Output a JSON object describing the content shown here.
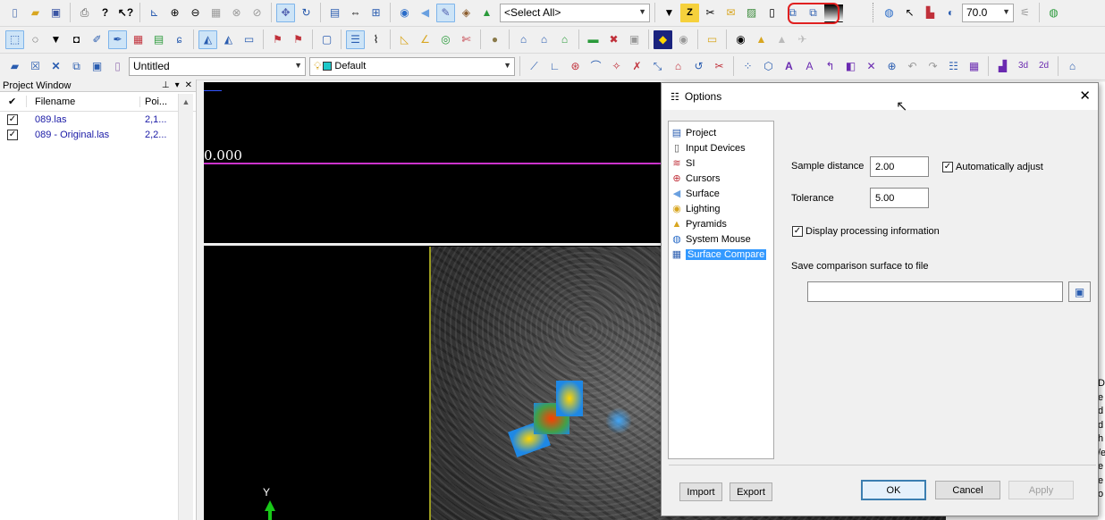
{
  "toolbar1": {
    "layer_select": "<Select All>",
    "zoom_value": "70.0"
  },
  "toolbar3": {
    "project_name": "Untitled",
    "style_select": "Default"
  },
  "project_window": {
    "title": "Project Window",
    "col_check": "✔",
    "col_filename": "Filename",
    "col_points": "Poi...",
    "files": [
      {
        "name": "089.las",
        "points": "2,1...",
        "checked": true
      },
      {
        "name": "089 - Original.las",
        "points": "2,2...",
        "checked": true
      }
    ]
  },
  "viewport": {
    "profile_value": "0.000",
    "axis_label": "Y"
  },
  "dialog": {
    "title": "Options",
    "tree": [
      {
        "label": "Project",
        "icon": "project-icon",
        "selected": false
      },
      {
        "label": "Input Devices",
        "icon": "input-devices-icon",
        "selected": false
      },
      {
        "label": "SI",
        "icon": "si-icon",
        "selected": false
      },
      {
        "label": "Cursors",
        "icon": "crosshair-icon",
        "selected": false
      },
      {
        "label": "Surface",
        "icon": "surface-icon",
        "selected": false
      },
      {
        "label": "Lighting",
        "icon": "bulb-icon",
        "selected": false
      },
      {
        "label": "Pyramids",
        "icon": "pyramid-icon",
        "selected": false
      },
      {
        "label": "System Mouse",
        "icon": "mouse-icon",
        "selected": false
      },
      {
        "label": "Surface Compare",
        "icon": "surface-compare-icon",
        "selected": true
      }
    ],
    "sample_distance_label": "Sample distance",
    "sample_distance_value": "2.00",
    "auto_adjust_label": "Automatically adjust",
    "tolerance_label": "Tolerance",
    "tolerance_value": "5.00",
    "display_processing_label": "Display processing information",
    "save_surface_label": "Save comparison surface to file",
    "save_path_value": "",
    "import_label": "Import",
    "export_label": "Export",
    "ok_label": "OK",
    "cancel_label": "Cancel",
    "apply_label": "Apply"
  },
  "right_panel": {
    "fragments": [
      "D",
      "e",
      "d",
      "d",
      "h",
      "/e",
      "e",
      "e",
      "o"
    ]
  },
  "colors": {
    "selection": "#3399ff",
    "profile_line": "#cc33cc",
    "highlight": "#e02020",
    "link_text": "#1a1aa6"
  }
}
